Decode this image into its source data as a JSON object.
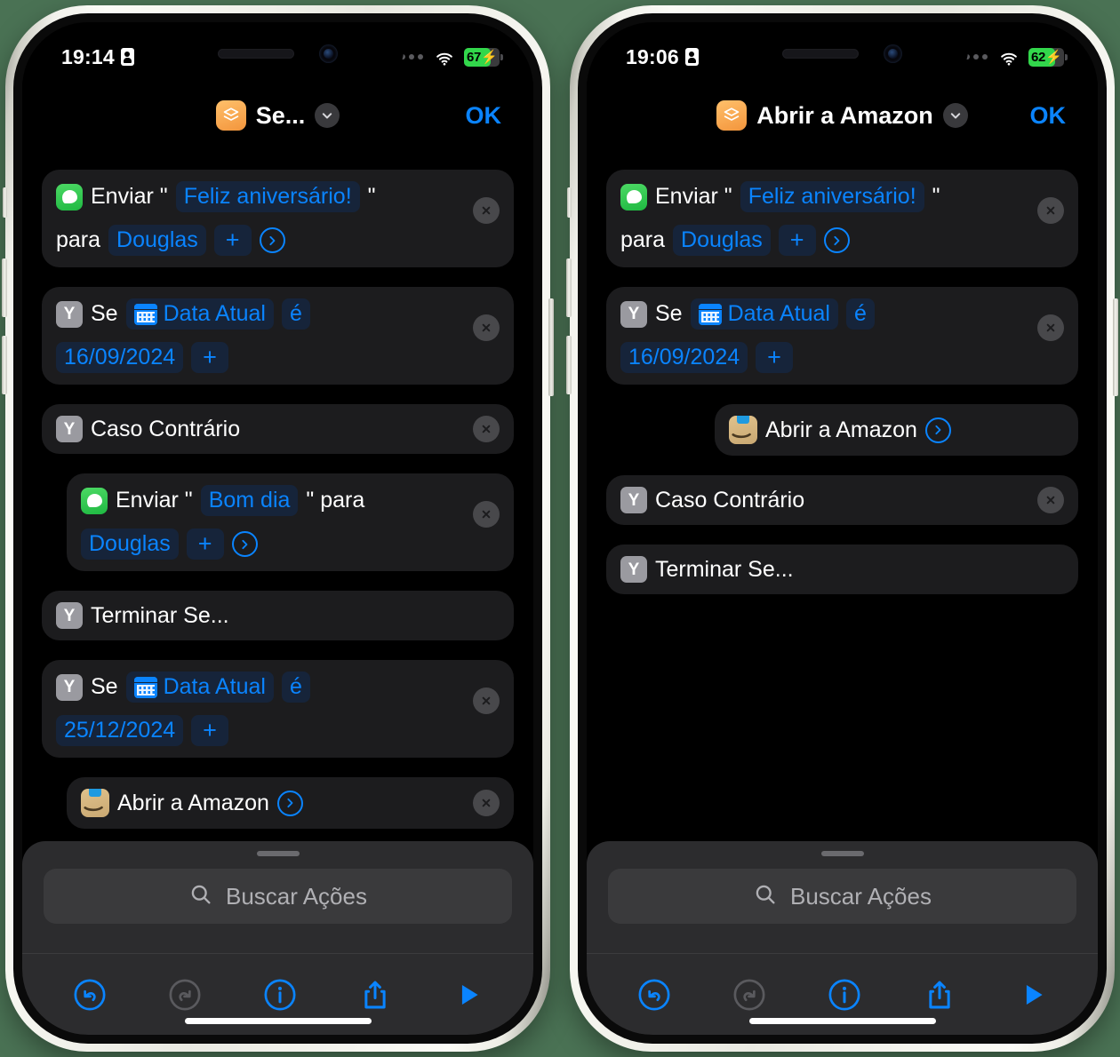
{
  "background_color": "#4a7254",
  "accent_color": "#0a84ff",
  "phones": [
    {
      "id": "left",
      "status": {
        "time": "19:14",
        "lock_icon": "lock-portrait-icon",
        "signal_icon": "signal-dots-icon",
        "wifi_icon": "wifi-icon",
        "battery_percent": "67",
        "battery_charging_icon": "lightning-bolt-icon",
        "battery_color": "#32d74b"
      },
      "nav": {
        "app_icon": "shortcuts-layers-icon",
        "title": "Se...",
        "chevron_icon": "chevron-down-icon",
        "done_label": "OK"
      },
      "actions": [
        {
          "name": "send-message-birthday",
          "icon": "messages-icon",
          "indent": 0,
          "two_line": true,
          "closable": true,
          "tokens": [
            {
              "type": "icon",
              "icon": "messages-icon"
            },
            {
              "type": "text",
              "text": "Enviar \""
            },
            {
              "type": "pill",
              "text": "Feliz aniversário!"
            },
            {
              "type": "text",
              "text": "\""
            },
            {
              "type": "break"
            },
            {
              "type": "text",
              "text": "para"
            },
            {
              "type": "pill",
              "text": "Douglas"
            },
            {
              "type": "plus",
              "text": "+"
            },
            {
              "type": "arrow",
              "icon": "chevron-right-circle-icon"
            }
          ]
        },
        {
          "name": "if-current-date-16-09",
          "icon": "if-branch-icon",
          "indent": 0,
          "two_line": true,
          "closable": true,
          "tokens": [
            {
              "type": "icon",
              "icon": "if-branch-icon"
            },
            {
              "type": "text",
              "text": "Se"
            },
            {
              "type": "pill-cal",
              "text": "Data Atual"
            },
            {
              "type": "pill",
              "text": "é"
            },
            {
              "type": "break"
            },
            {
              "type": "pill",
              "text": "16/09/2024"
            },
            {
              "type": "plus",
              "text": "+"
            }
          ]
        },
        {
          "name": "otherwise",
          "icon": "if-branch-icon",
          "indent": 0,
          "two_line": false,
          "closable": true,
          "tokens": [
            {
              "type": "icon",
              "icon": "if-branch-icon"
            },
            {
              "type": "text",
              "text": "Caso Contrário"
            }
          ]
        },
        {
          "name": "send-message-goodmorning",
          "icon": "messages-icon",
          "indent": 1,
          "two_line": true,
          "closable": true,
          "tokens": [
            {
              "type": "icon",
              "icon": "messages-icon"
            },
            {
              "type": "text",
              "text": "Enviar \""
            },
            {
              "type": "pill",
              "text": "Bom dia"
            },
            {
              "type": "text",
              "text": "\" para"
            },
            {
              "type": "break"
            },
            {
              "type": "pill",
              "text": "Douglas"
            },
            {
              "type": "plus",
              "text": "+"
            },
            {
              "type": "arrow",
              "icon": "chevron-right-circle-icon"
            }
          ]
        },
        {
          "name": "end-if-1",
          "icon": "if-branch-icon",
          "indent": 0,
          "two_line": false,
          "closable": false,
          "tokens": [
            {
              "type": "icon",
              "icon": "if-branch-icon"
            },
            {
              "type": "text",
              "text": "Terminar Se..."
            }
          ]
        },
        {
          "name": "if-current-date-25-12",
          "icon": "if-branch-icon",
          "indent": 0,
          "two_line": true,
          "closable": true,
          "tokens": [
            {
              "type": "icon",
              "icon": "if-branch-icon"
            },
            {
              "type": "text",
              "text": "Se"
            },
            {
              "type": "pill-cal",
              "text": "Data Atual"
            },
            {
              "type": "pill",
              "text": "é"
            },
            {
              "type": "break"
            },
            {
              "type": "pill",
              "text": "25/12/2024"
            },
            {
              "type": "plus",
              "text": "+"
            }
          ]
        },
        {
          "name": "open-amazon",
          "icon": "amazon-icon",
          "indent": 1,
          "two_line": false,
          "closable": true,
          "tokens": [
            {
              "type": "icon",
              "icon": "amazon-icon"
            },
            {
              "type": "text",
              "text": "Abrir a Amazon"
            },
            {
              "type": "arrow",
              "icon": "chevron-right-circle-icon"
            }
          ]
        }
      ],
      "sheet": {
        "grabber": "sheet-grabber",
        "search_placeholder": "Buscar Ações",
        "search_icon": "search-icon"
      },
      "toolbar": [
        {
          "name": "undo-button",
          "icon": "undo-icon",
          "enabled": true
        },
        {
          "name": "redo-button",
          "icon": "redo-icon",
          "enabled": false
        },
        {
          "name": "info-button",
          "icon": "info-circle-icon",
          "enabled": true
        },
        {
          "name": "share-button",
          "icon": "share-icon",
          "enabled": true
        },
        {
          "name": "run-button",
          "icon": "play-icon",
          "enabled": true
        }
      ]
    },
    {
      "id": "right",
      "status": {
        "time": "19:06",
        "lock_icon": "lock-portrait-icon",
        "signal_icon": "signal-dots-icon",
        "wifi_icon": "wifi-icon",
        "battery_percent": "62",
        "battery_charging_icon": "lightning-bolt-icon",
        "battery_color": "#32d74b"
      },
      "nav": {
        "app_icon": "shortcuts-layers-icon",
        "title": "Abrir a Amazon",
        "chevron_icon": "chevron-down-icon",
        "done_label": "OK"
      },
      "actions": [
        {
          "name": "send-message-birthday",
          "icon": "messages-icon",
          "indent": 0,
          "two_line": true,
          "closable": true,
          "tokens": [
            {
              "type": "icon",
              "icon": "messages-icon"
            },
            {
              "type": "text",
              "text": "Enviar \""
            },
            {
              "type": "pill",
              "text": "Feliz aniversário!"
            },
            {
              "type": "text",
              "text": "\""
            },
            {
              "type": "break"
            },
            {
              "type": "text",
              "text": "para"
            },
            {
              "type": "pill",
              "text": "Douglas"
            },
            {
              "type": "plus",
              "text": "+"
            },
            {
              "type": "arrow",
              "icon": "chevron-right-circle-icon"
            }
          ]
        },
        {
          "name": "if-current-date-16-09",
          "icon": "if-branch-icon",
          "indent": 0,
          "two_line": true,
          "closable": true,
          "tokens": [
            {
              "type": "icon",
              "icon": "if-branch-icon"
            },
            {
              "type": "text",
              "text": "Se"
            },
            {
              "type": "pill-cal",
              "text": "Data Atual"
            },
            {
              "type": "pill",
              "text": "é"
            },
            {
              "type": "break"
            },
            {
              "type": "pill",
              "text": "16/09/2024"
            },
            {
              "type": "plus",
              "text": "+"
            }
          ]
        },
        {
          "name": "open-amazon-dragged",
          "icon": "amazon-icon",
          "indent": 2,
          "two_line": false,
          "closable": false,
          "tokens": [
            {
              "type": "icon",
              "icon": "amazon-icon"
            },
            {
              "type": "text",
              "text": "Abrir a Amazon"
            },
            {
              "type": "arrow",
              "icon": "chevron-right-circle-icon"
            }
          ]
        },
        {
          "name": "otherwise",
          "icon": "if-branch-icon",
          "indent": 0,
          "two_line": false,
          "closable": true,
          "tokens": [
            {
              "type": "icon",
              "icon": "if-branch-icon"
            },
            {
              "type": "text",
              "text": "Caso Contrário"
            }
          ]
        },
        {
          "name": "end-if-1",
          "icon": "if-branch-icon",
          "indent": 0,
          "two_line": false,
          "closable": false,
          "tokens": [
            {
              "type": "icon",
              "icon": "if-branch-icon"
            },
            {
              "type": "text",
              "text": "Terminar Se..."
            }
          ]
        }
      ],
      "sheet": {
        "grabber": "sheet-grabber",
        "search_placeholder": "Buscar Ações",
        "search_icon": "search-icon"
      },
      "toolbar": [
        {
          "name": "undo-button",
          "icon": "undo-icon",
          "enabled": true
        },
        {
          "name": "redo-button",
          "icon": "redo-icon",
          "enabled": false
        },
        {
          "name": "info-button",
          "icon": "info-circle-icon",
          "enabled": true
        },
        {
          "name": "share-button",
          "icon": "share-icon",
          "enabled": true
        },
        {
          "name": "run-button",
          "icon": "play-icon",
          "enabled": true
        }
      ]
    }
  ]
}
